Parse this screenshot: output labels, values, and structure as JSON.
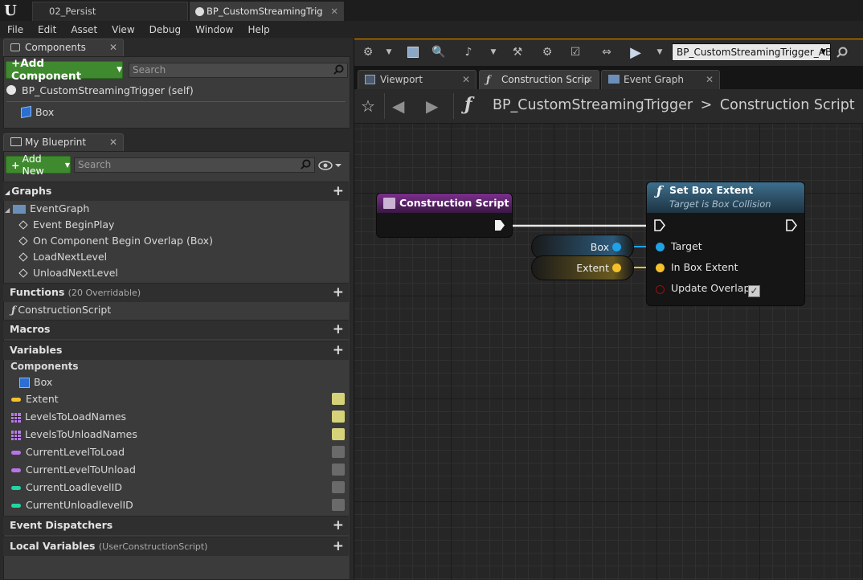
{
  "titlebar": {
    "tabs": [
      {
        "label": "02_Persist"
      },
      {
        "label": "BP_CustomStreamingTrig"
      }
    ]
  },
  "menu": [
    "File",
    "Edit",
    "Asset",
    "View",
    "Debug",
    "Window",
    "Help"
  ],
  "components_panel": {
    "tab_label": "Components",
    "add_button": "+Add Component",
    "search_placeholder": "Search",
    "root": "BP_CustomStreamingTrigger (self)",
    "child": "Box"
  },
  "my_blueprint": {
    "tab_label": "My Blueprint",
    "add_new": "Add New",
    "search_placeholder": "Search",
    "graphs_header": "Graphs",
    "event_graph": "EventGraph",
    "events": [
      "Event BeginPlay",
      "On Component Begin Overlap (Box)",
      "LoadNextLevel",
      "UnloadNextLevel"
    ],
    "functions_header": "Functions",
    "functions_sub": "(20 Overridable)",
    "function_item": "ConstructionScript",
    "macros_header": "Macros",
    "variables_header": "Variables",
    "components_category": "Components",
    "variables": [
      {
        "name": "Box",
        "type": "component"
      },
      {
        "name": "Extent",
        "type": "vector",
        "visible": true
      },
      {
        "name": "LevelsToLoadNames",
        "type": "array",
        "visible": true
      },
      {
        "name": "LevelsToUnloadNames",
        "type": "array",
        "visible": true
      },
      {
        "name": "CurrentLevelToLoad",
        "type": "name",
        "visible": false
      },
      {
        "name": "CurrentLevelToUnload",
        "type": "name",
        "visible": false
      },
      {
        "name": "CurrentLoadlevelID",
        "type": "int",
        "visible": false
      },
      {
        "name": "CurrentUnloadlevelID",
        "type": "int",
        "visible": false
      }
    ],
    "dispatchers_header": "Event Dispatchers",
    "locals_header": "Local Variables",
    "locals_sub": "(UserConstructionScript)"
  },
  "toolbar": {
    "blueprint_select": "BP_CustomStreamingTrigger_AB"
  },
  "graph_tabs": [
    "Viewport",
    "Construction Scrip",
    "Event Graph"
  ],
  "breadcrumb": {
    "blueprint": "BP_CustomStreamingTrigger",
    "separator": ">",
    "graph": "Construction Script"
  },
  "nodes": {
    "construction_script": "Construction Script",
    "set_box_extent": {
      "title": "Set Box Extent",
      "subtitle": "Target is Box Collision",
      "pins": [
        "Target",
        "In Box Extent",
        "Update Overlaps"
      ]
    },
    "box_getter": "Box",
    "extent_getter": "Extent"
  },
  "colors": {
    "accent": "#ff9d00",
    "object_pin": "#1fa3e6",
    "vector_pin": "#f4c12a",
    "bool_pin": "#9b0d0d",
    "array_icon": "#b67ce2",
    "name_pill": "#b874e8",
    "int_pill": "#20d6a4"
  }
}
